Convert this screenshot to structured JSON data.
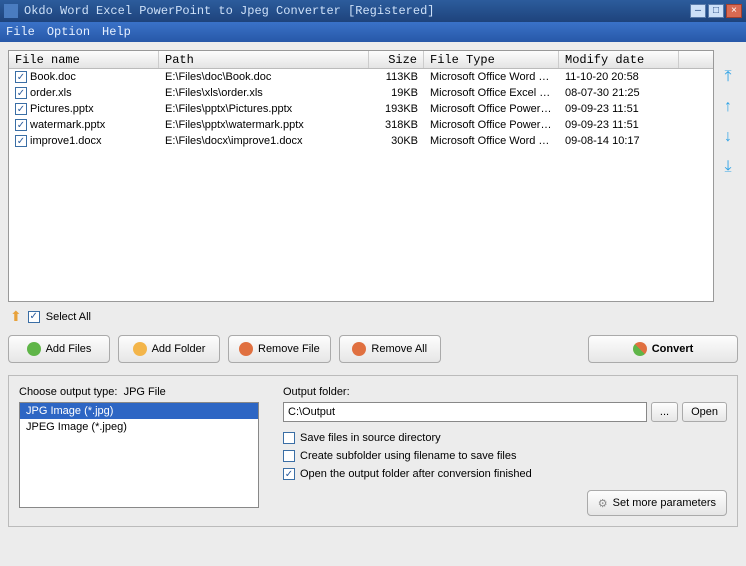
{
  "title": "Okdo Word Excel PowerPoint to Jpeg Converter [Registered]",
  "menu": {
    "file": "File",
    "option": "Option",
    "help": "Help"
  },
  "columns": {
    "name": "File name",
    "path": "Path",
    "size": "Size",
    "type": "File Type",
    "date": "Modify date"
  },
  "files": [
    {
      "name": "Book.doc",
      "path": "E:\\Files\\doc\\Book.doc",
      "size": "113KB",
      "type": "Microsoft Office Word 9...",
      "date": "11-10-20 20:58",
      "checked": true
    },
    {
      "name": "order.xls",
      "path": "E:\\Files\\xls\\order.xls",
      "size": "19KB",
      "type": "Microsoft Office Excel 9...",
      "date": "08-07-30 21:25",
      "checked": true
    },
    {
      "name": "Pictures.pptx",
      "path": "E:\\Files\\pptx\\Pictures.pptx",
      "size": "193KB",
      "type": "Microsoft Office PowerP...",
      "date": "09-09-23 11:51",
      "checked": true
    },
    {
      "name": "watermark.pptx",
      "path": "E:\\Files\\pptx\\watermark.pptx",
      "size": "318KB",
      "type": "Microsoft Office PowerP...",
      "date": "09-09-23 11:51",
      "checked": true
    },
    {
      "name": "improve1.docx",
      "path": "E:\\Files\\docx\\improve1.docx",
      "size": "30KB",
      "type": "Microsoft Office Word D...",
      "date": "09-08-14 10:17",
      "checked": true
    }
  ],
  "selectAll": {
    "label": "Select All",
    "checked": true
  },
  "buttons": {
    "addFiles": "Add Files",
    "addFolder": "Add Folder",
    "removeFile": "Remove File",
    "removeAll": "Remove All",
    "convert": "Convert"
  },
  "outputType": {
    "label": "Choose output type:",
    "current": "JPG File",
    "options": [
      "JPG Image (*.jpg)",
      "JPEG Image (*.jpeg)"
    ],
    "selectedIndex": 0
  },
  "outputFolder": {
    "label": "Output folder:",
    "value": "C:\\Output",
    "browse": "...",
    "open": "Open"
  },
  "checks": {
    "saveInSource": {
      "label": "Save files in source directory",
      "checked": false
    },
    "createSubfolder": {
      "label": "Create subfolder using filename to save files",
      "checked": false
    },
    "openAfter": {
      "label": "Open the output folder after conversion finished",
      "checked": true
    }
  },
  "setMore": "Set more parameters"
}
